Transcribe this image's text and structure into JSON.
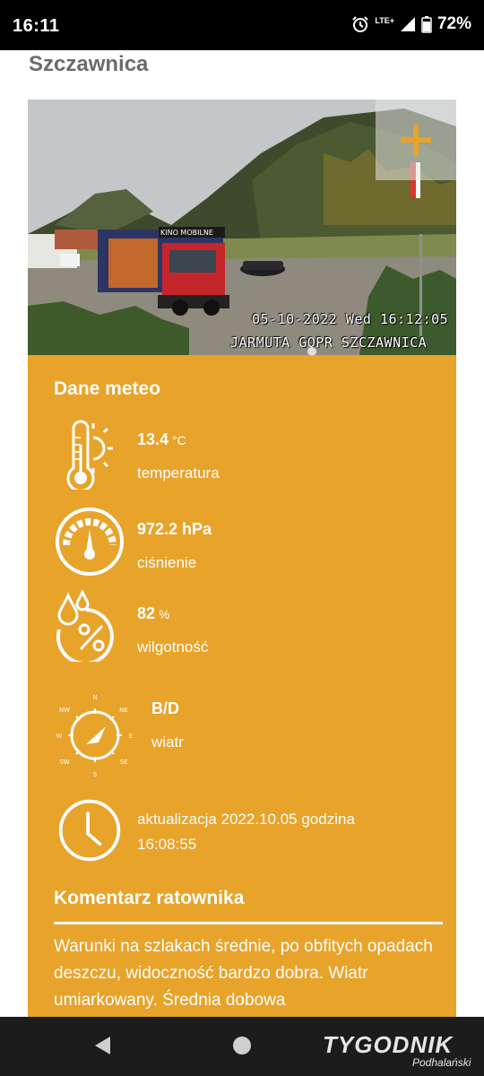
{
  "status_bar": {
    "time": "16:11",
    "network": "LTE+",
    "battery": "72%"
  },
  "page": {
    "title": "Szczawnica"
  },
  "webcam": {
    "timestamp_overlay": "05-10-2022 Wed 16:12:05",
    "location_overlay": "JARMUTA GOPR SZCZAWNICA",
    "truck_sign": "KINO MOBILNE"
  },
  "meteo": {
    "heading": "Dane meteo",
    "temperature": {
      "value": "13.4",
      "unit": "°C",
      "label": "temperatura"
    },
    "pressure": {
      "value": "972.2 hPa",
      "label": "ciśnienie"
    },
    "humidity": {
      "value": "82",
      "unit": "%",
      "label": "wilgotność"
    },
    "wind": {
      "value": "B/D",
      "label": "wiatr",
      "compass": [
        "N",
        "NE",
        "E",
        "SE",
        "S",
        "SW",
        "W",
        "NW"
      ]
    },
    "update": {
      "line1": "aktualizacja 2022.10.05 godzina",
      "line2": "16:08:55"
    }
  },
  "comment": {
    "heading": "Komentarz ratownika",
    "text": "Warunki na szlakach średnie, po obfitych opadach deszczu, widoczność bardzo dobra. Wiatr umiarkowany. Średnia dobowa"
  },
  "nav": {
    "logo": "TYGODNIK",
    "logo_sub": "Podhalański"
  },
  "colors": {
    "accent": "#e8a32a",
    "status_bar": "#000000",
    "nav_bar": "#1c1c1c"
  }
}
